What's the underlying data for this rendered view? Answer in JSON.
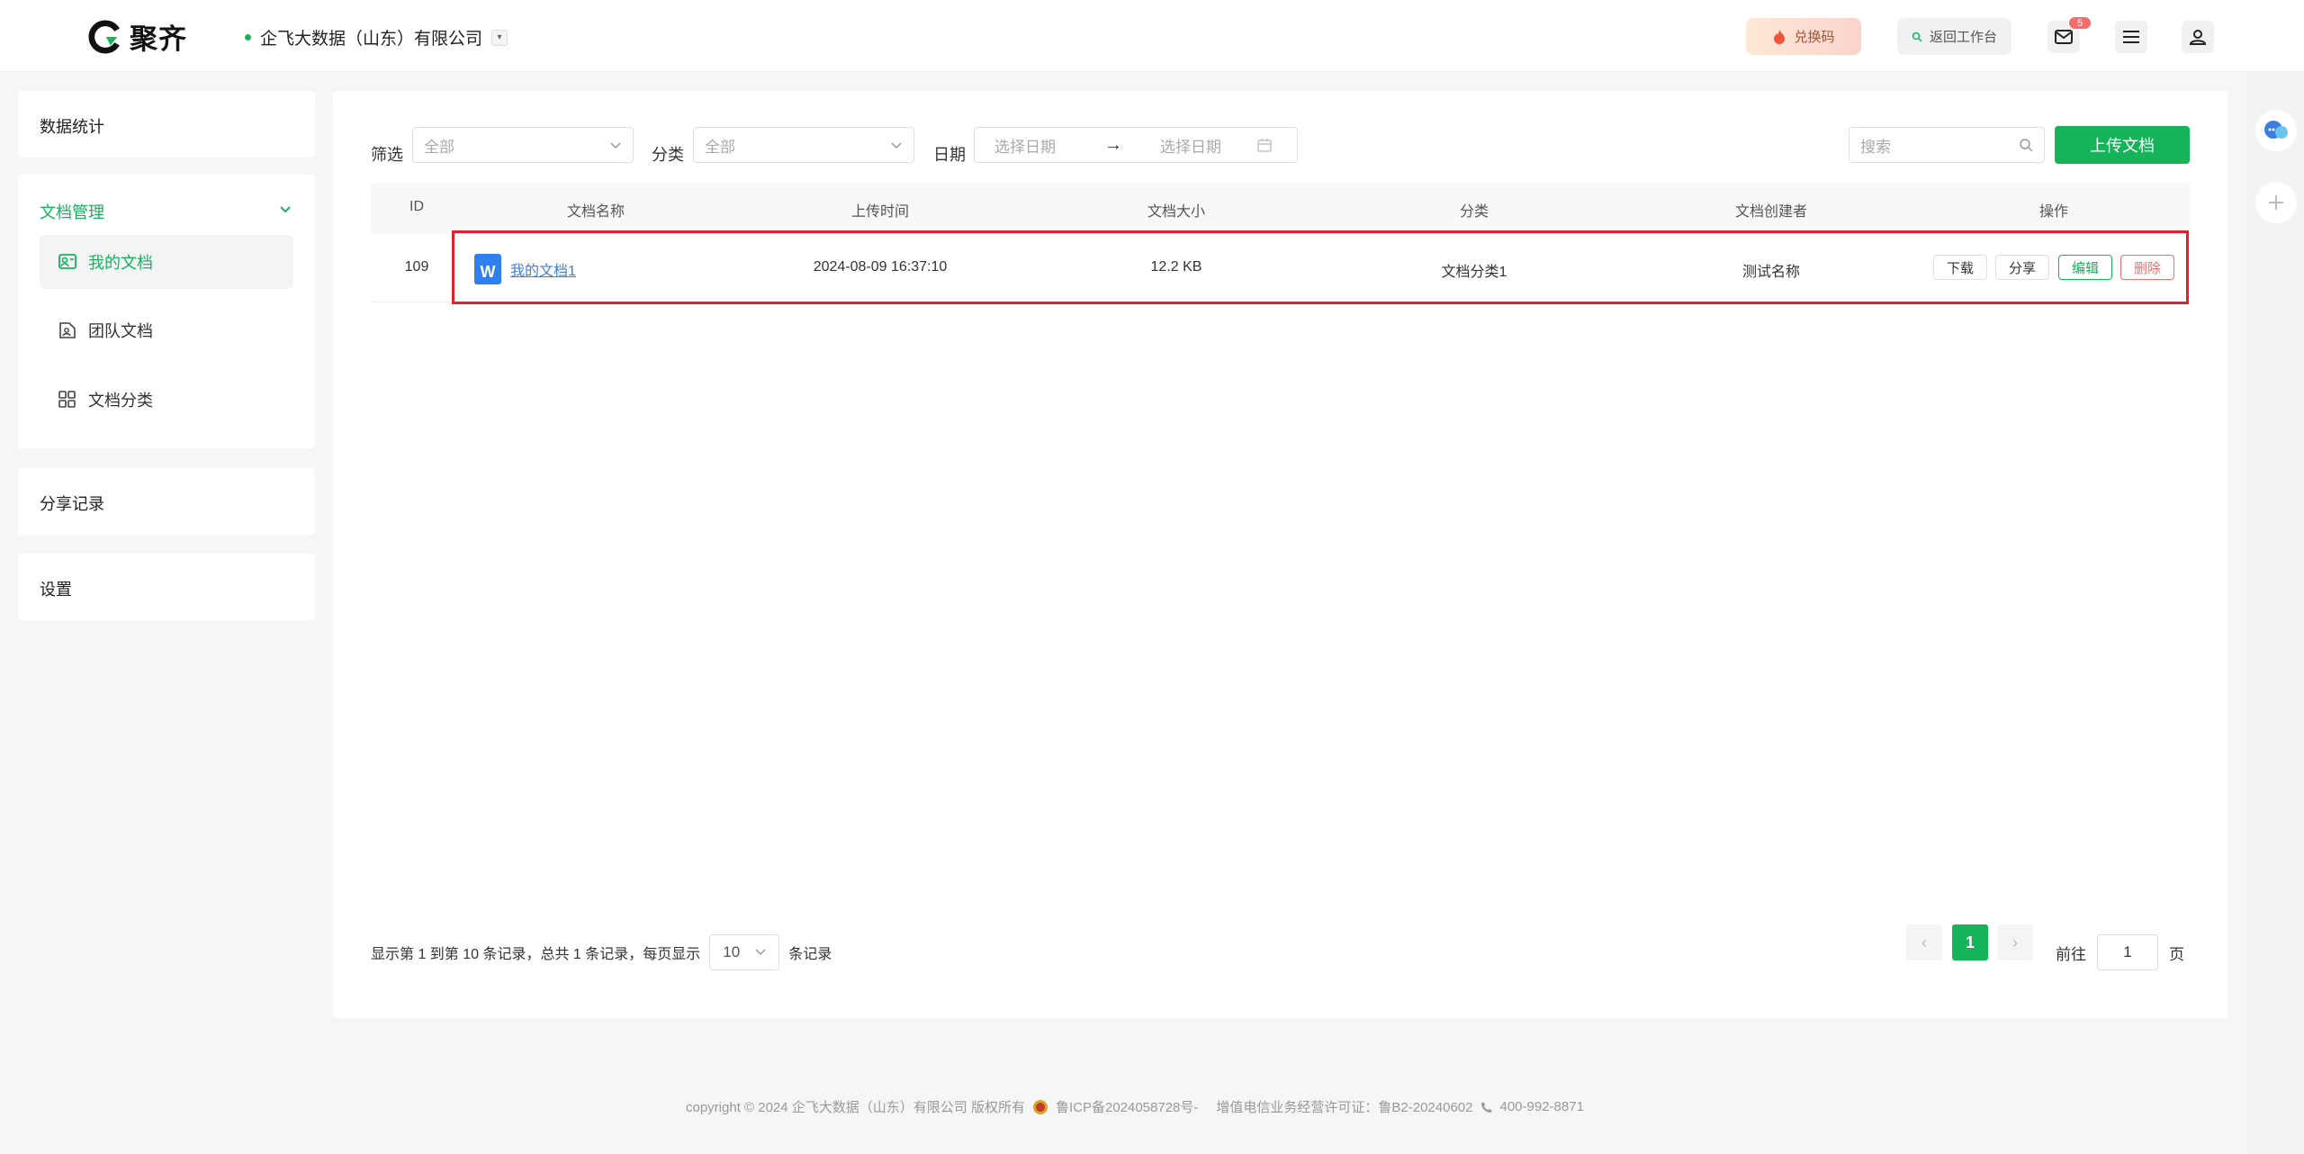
{
  "header": {
    "brand": "聚齐",
    "company": "企飞大数据（山东）有限公司",
    "redeem_label": "兑换码",
    "back_label": "返回工作台",
    "mail_badge": "5"
  },
  "sidebar": {
    "stats": "数据统计",
    "doc_manage": "文档管理",
    "items": [
      {
        "label": "我的文档"
      },
      {
        "label": "团队文档"
      },
      {
        "label": "文档分类"
      }
    ],
    "share_records": "分享记录",
    "settings": "设置"
  },
  "filters": {
    "filter_label": "筛选",
    "filter_value": "全部",
    "category_label": "分类",
    "category_value": "全部",
    "date_label": "日期",
    "date_start": "选择日期",
    "date_sep": "→",
    "date_end": "选择日期",
    "search_placeholder": "搜索",
    "upload_label": "上传文档"
  },
  "table": {
    "columns": [
      "ID",
      "文档名称",
      "上传时间",
      "文档大小",
      "分类",
      "文档创建者",
      "操作"
    ],
    "rows": [
      {
        "id": "109",
        "name": "我的文档1",
        "uploaded": "2024-08-09 16:37:10",
        "size": "12.2 KB",
        "category": "文档分类1",
        "creator": "测试名称",
        "actions": [
          "下载",
          "分享",
          "编辑",
          "删除"
        ]
      }
    ]
  },
  "pagination": {
    "info": "显示第 1 到第 10 条记录，总共 1 条记录，每页显示",
    "page_size": "10",
    "suffix": "条记录",
    "current_page": "1",
    "goto_label": "前往",
    "goto_value": "1",
    "page_unit": "页"
  },
  "footer": {
    "copyright": "copyright © 2024 企飞大数据（山东）有限公司 版权所有",
    "icp": "鲁ICP备2024058728号-",
    "license": "增值电信业务经营许可证：鲁B2-20240602",
    "phone": "400-992-8871"
  },
  "colors": {
    "accent": "#16b35b",
    "danger": "#f56c6c",
    "link": "#3d7fe0",
    "highlight": "#e5202e"
  }
}
